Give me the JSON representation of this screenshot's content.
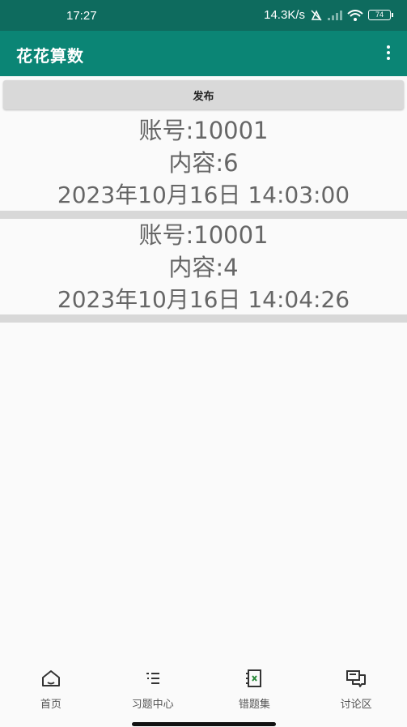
{
  "status_bar": {
    "time": "17:27",
    "network_speed": "14.3K/s",
    "battery": "74"
  },
  "app_bar": {
    "title": "花花算数"
  },
  "publish_button_label": "发布",
  "posts": [
    {
      "account": "账号:10001",
      "content": "内容:6",
      "datetime": "2023年10月16日 14:03:00"
    },
    {
      "account": "账号:10001",
      "content": "内容:4",
      "datetime": "2023年10月16日 14:04:26"
    }
  ],
  "bottom_nav": [
    {
      "label": "首页",
      "icon": "home-icon"
    },
    {
      "label": "习题中心",
      "icon": "list-icon"
    },
    {
      "label": "错题集",
      "icon": "notebook-icon"
    },
    {
      "label": "讨论区",
      "icon": "chat-icon"
    }
  ],
  "colors": {
    "status_bar": "#0e6b5e",
    "app_bar": "#0b8575",
    "background": "#fafafa",
    "separator": "#d8d8d8"
  }
}
